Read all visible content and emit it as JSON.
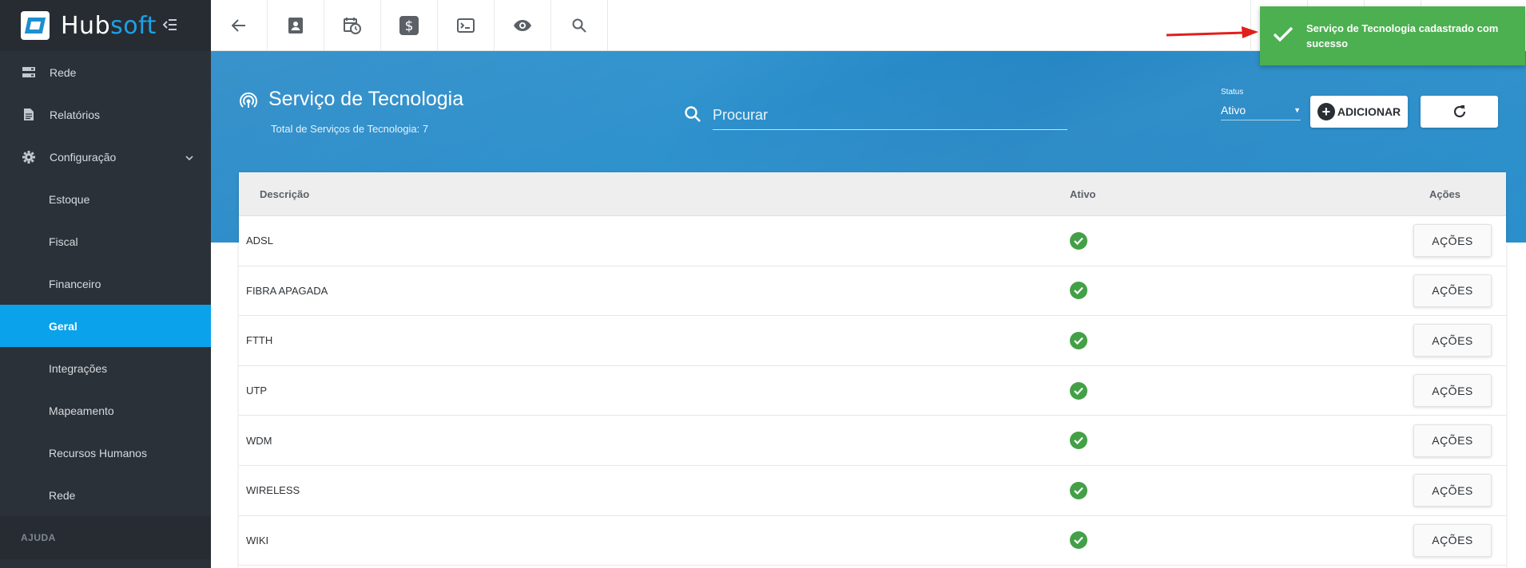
{
  "app": {
    "logo_text_a": "Hub",
    "logo_text_b": "soft"
  },
  "sidebar": {
    "items": [
      {
        "label": "Rede",
        "icon": "server-icon"
      },
      {
        "label": "Relatórios",
        "icon": "document-icon"
      },
      {
        "label": "Configuração",
        "icon": "gear-icon"
      }
    ],
    "subitems": [
      "Estoque",
      "Fiscal",
      "Financeiro",
      "Geral",
      "Integrações",
      "Mapeamento",
      "Recursos Humanos",
      "Rede"
    ],
    "active_subitem": "Geral",
    "section_label": "AJUDA"
  },
  "topbar": {
    "buttons": [
      "back-arrow-icon",
      "contact-card-icon",
      "calendar-clock-icon",
      "dollar-icon",
      "terminal-icon",
      "eye-icon",
      "search-icon"
    ]
  },
  "header": {
    "title": "Serviço de Tecnologia",
    "subtitle": "Total de Serviços de Tecnologia: 7",
    "search_placeholder": "Procurar",
    "status_label": "Status",
    "status_value": "Ativo",
    "add_label": "ADICIONAR"
  },
  "table": {
    "columns": [
      "Descrição",
      "Ativo",
      "Ações"
    ],
    "rows": [
      {
        "descricao": "ADSL",
        "ativo": true,
        "acao": "AÇÕES"
      },
      {
        "descricao": "FIBRA APAGADA",
        "ativo": true,
        "acao": "AÇÕES"
      },
      {
        "descricao": "FTTH",
        "ativo": true,
        "acao": "AÇÕES"
      },
      {
        "descricao": "UTP",
        "ativo": true,
        "acao": "AÇÕES"
      },
      {
        "descricao": "WDM",
        "ativo": true,
        "acao": "AÇÕES"
      },
      {
        "descricao": "WIRELESS",
        "ativo": true,
        "acao": "AÇÕES"
      },
      {
        "descricao": "WIKI",
        "ativo": true,
        "acao": "AÇÕES"
      }
    ]
  },
  "toast": {
    "message": "Serviço de Tecnologia cadastrado com sucesso"
  },
  "colors": {
    "sidebar": "#2b3138",
    "active": "#0aa2ea",
    "hero": "#2a8ac7",
    "success": "#4caf50",
    "annotation_arrow": "#e0201c"
  }
}
